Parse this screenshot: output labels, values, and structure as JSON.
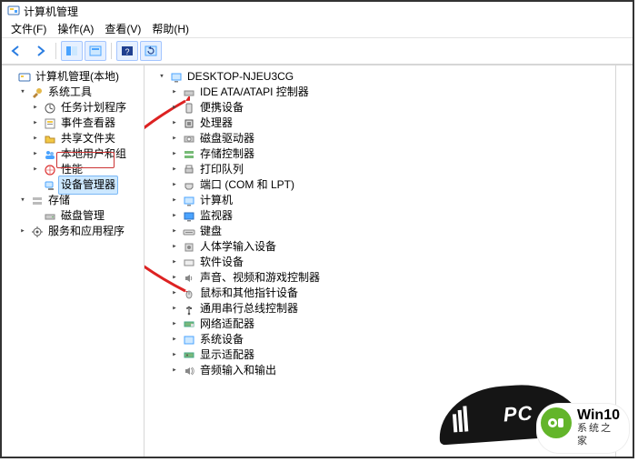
{
  "window": {
    "title": "计算机管理"
  },
  "menu": {
    "file": "文件(F)",
    "action": "操作(A)",
    "view": "查看(V)",
    "help": "帮助(H)"
  },
  "leftTree": {
    "root": "计算机管理(本地)",
    "systemTools": "系统工具",
    "taskSched": "任务计划程序",
    "eventViewer": "事件查看器",
    "sharedFolders": "共享文件夹",
    "localUsers": "本地用户和组",
    "perf": "性能",
    "deviceMgr": "设备管理器",
    "storage": "存储",
    "diskMgmt": "磁盘管理",
    "services": "服务和应用程序"
  },
  "rightTree": {
    "host": "DESKTOP-NJEU3CG",
    "ideAta": "IDE ATA/ATAPI 控制器",
    "portable": "便携设备",
    "cpu": "处理器",
    "diskDrives": "磁盘驱动器",
    "storageCtl": "存储控制器",
    "printQueue": "打印队列",
    "ports": "端口 (COM 和 LPT)",
    "computer": "计算机",
    "monitors": "监视器",
    "keyboards": "键盘",
    "hid": "人体学输入设备",
    "software": "软件设备",
    "avGame": "声音、视频和游戏控制器",
    "mice": "鼠标和其他指针设备",
    "usb": "通用串行总线控制器",
    "netAdapters": "网络适配器",
    "sysDevices": "系统设备",
    "display": "显示适配器",
    "audioIO": "音频输入和输出"
  },
  "watermark": {
    "line1": "Win10",
    "line2": "系统之家"
  }
}
